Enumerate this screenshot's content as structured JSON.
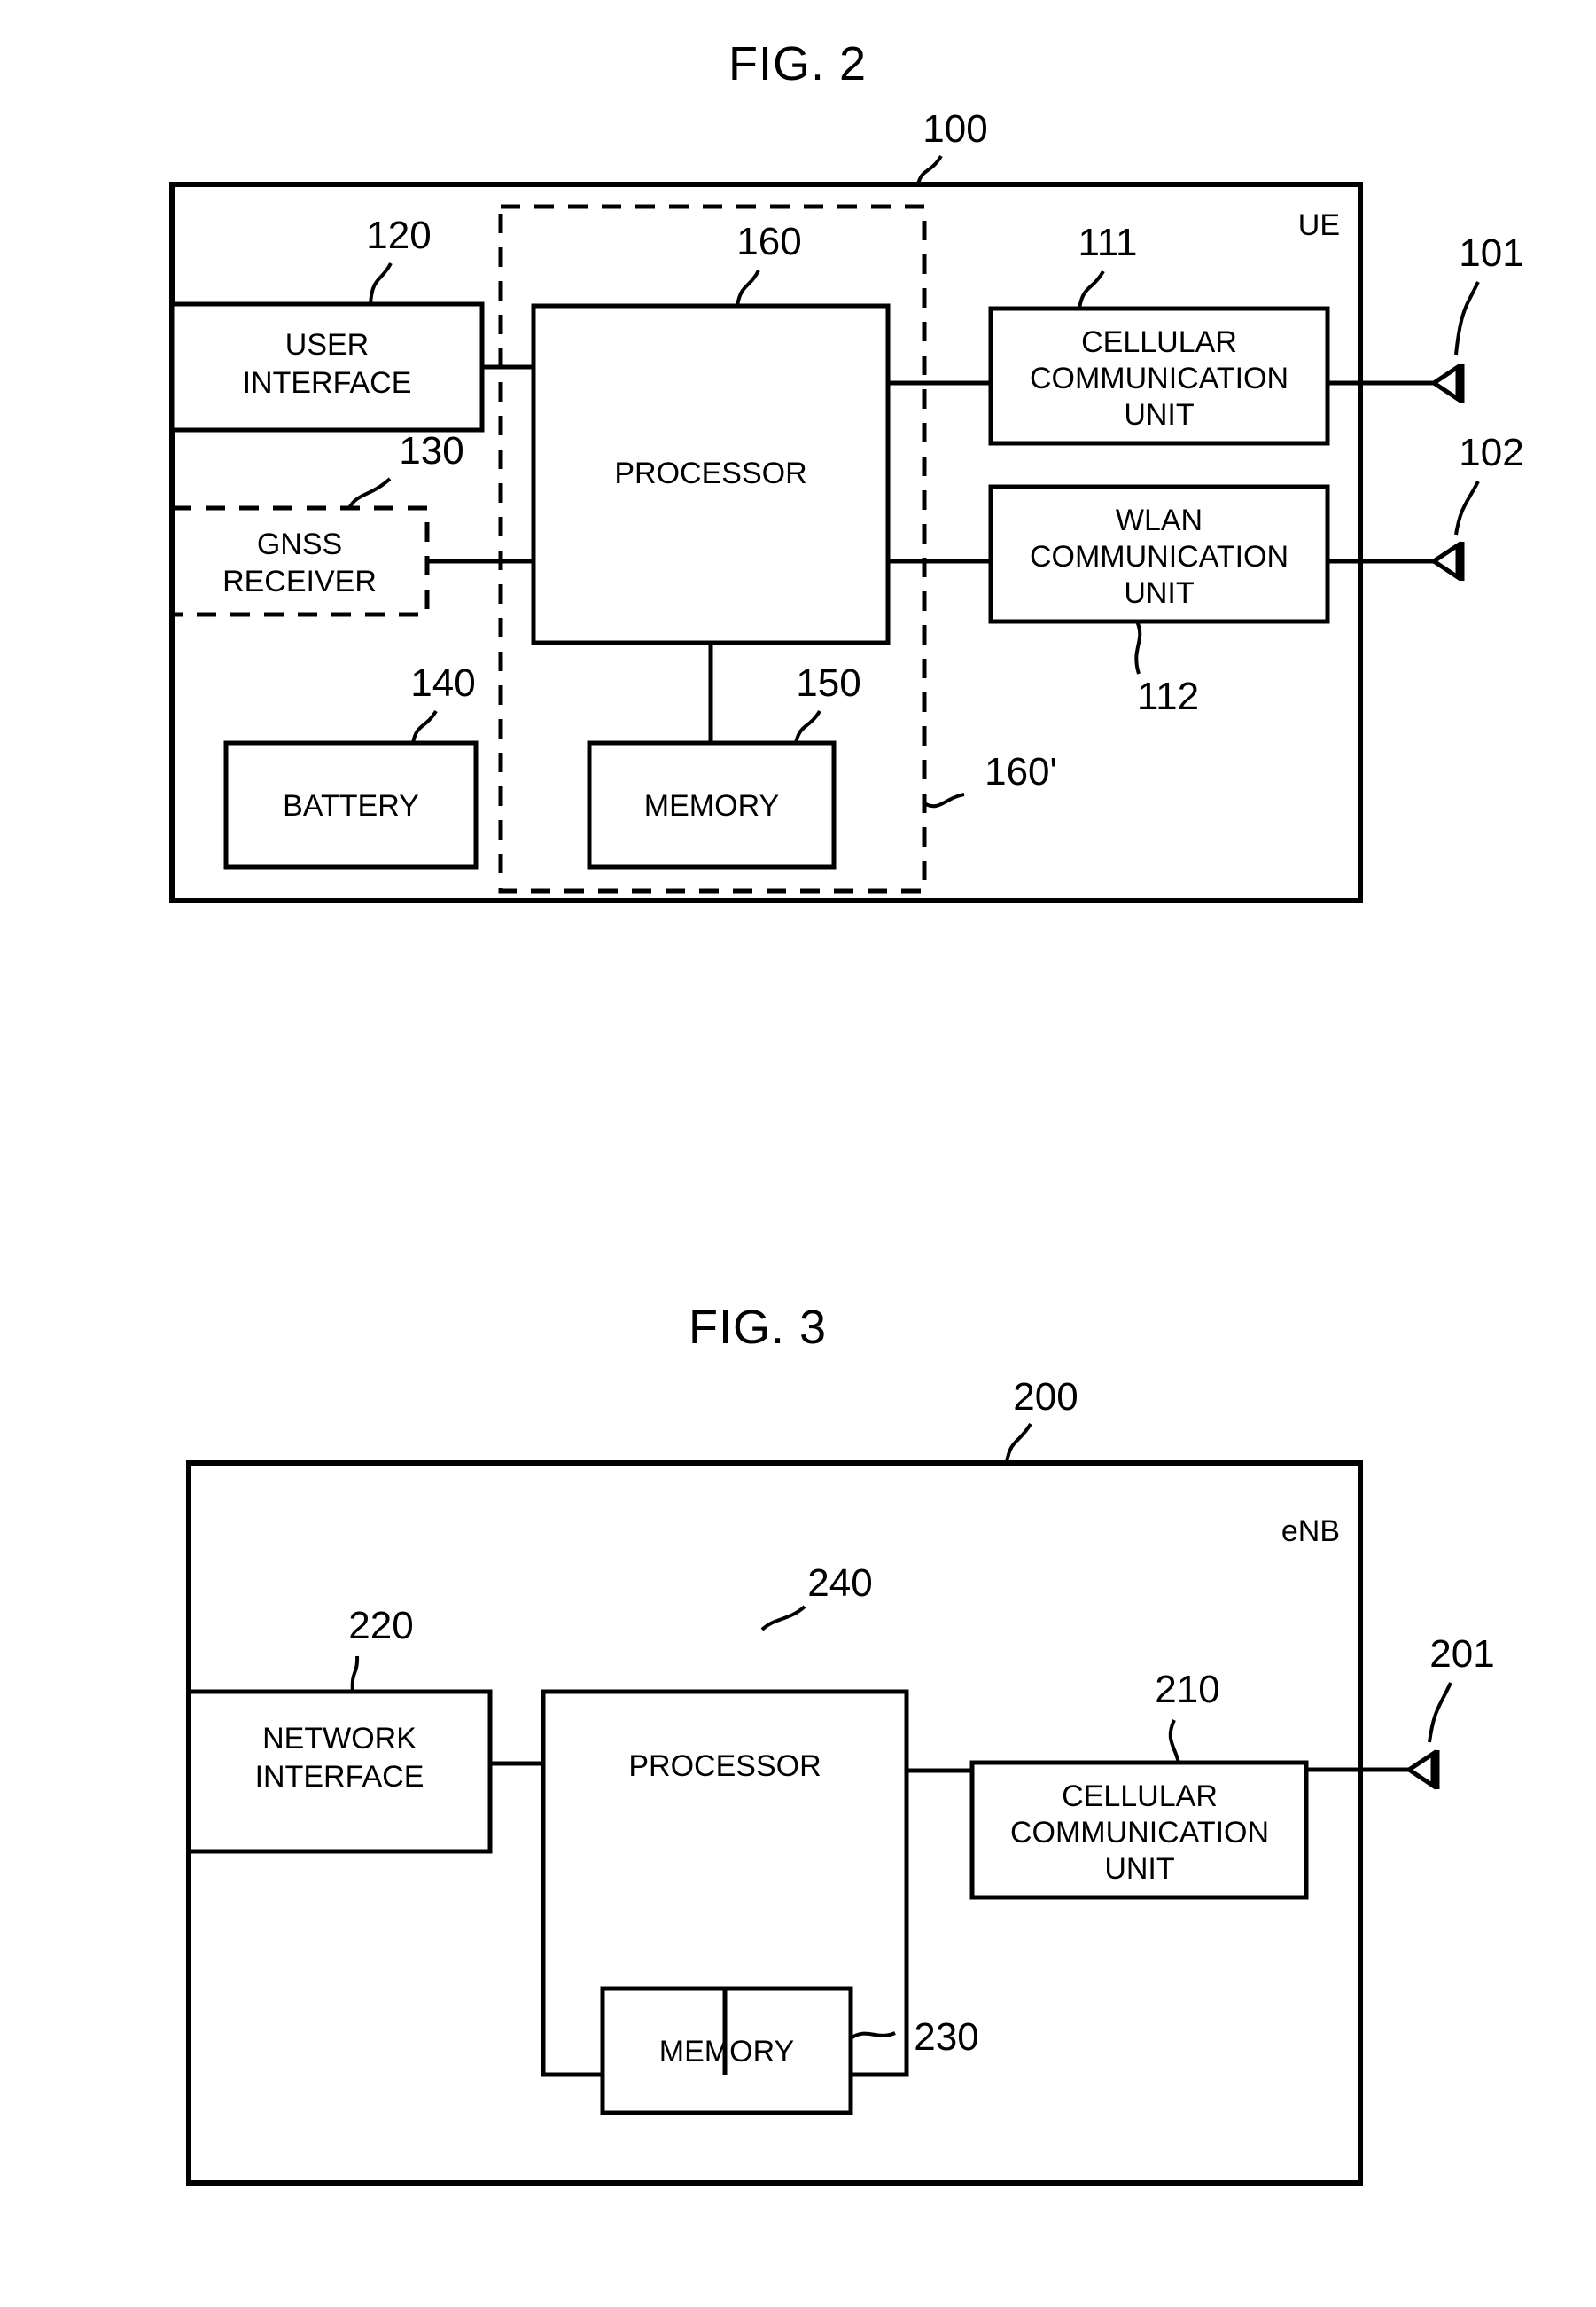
{
  "figures": [
    {
      "id": "fig2",
      "title": "FIG. 2",
      "outer": {
        "ref": "100",
        "entity_label": "UE"
      },
      "blocks": [
        {
          "key": "user_interface",
          "lines": [
            "USER",
            "INTERFACE"
          ],
          "ref": "120",
          "style": "solid"
        },
        {
          "key": "gnss_receiver",
          "lines": [
            "GNSS",
            "RECEIVER"
          ],
          "ref": "130",
          "style": "dashed"
        },
        {
          "key": "battery",
          "lines": [
            "BATTERY"
          ],
          "ref": "140",
          "style": "solid"
        },
        {
          "key": "processor",
          "lines": [
            "PROCESSOR"
          ],
          "ref": "160",
          "style": "solid"
        },
        {
          "key": "memory",
          "lines": [
            "MEMORY"
          ],
          "ref": "150",
          "style": "solid"
        },
        {
          "key": "cellular_communication_unit",
          "lines": [
            "CELLULAR",
            "COMMUNICATION",
            "UNIT"
          ],
          "ref": "111",
          "style": "solid"
        },
        {
          "key": "wlan_communication_unit",
          "lines": [
            "WLAN",
            "COMMUNICATION",
            "UNIT"
          ],
          "ref": "112",
          "style": "solid"
        }
      ],
      "dashed_group": {
        "key": "processor_memory_group",
        "ref": "160'"
      },
      "antennas": [
        {
          "key": "cellular_antenna",
          "ref": "101"
        },
        {
          "key": "wlan_antenna",
          "ref": "102"
        }
      ]
    },
    {
      "id": "fig3",
      "title": "FIG. 3",
      "outer": {
        "ref": "200",
        "entity_label": "eNB"
      },
      "blocks": [
        {
          "key": "network_interface",
          "lines": [
            "NETWORK",
            "INTERFACE"
          ],
          "ref": "220",
          "style": "solid"
        },
        {
          "key": "processor",
          "lines": [
            "PROCESSOR"
          ],
          "ref": "240",
          "style": "solid"
        },
        {
          "key": "memory",
          "lines": [
            "MEMORY"
          ],
          "ref": "230",
          "style": "solid"
        },
        {
          "key": "cellular_communication_unit",
          "lines": [
            "CELLULAR",
            "COMMUNICATION",
            "UNIT"
          ],
          "ref": "210",
          "style": "solid"
        }
      ],
      "antennas": [
        {
          "key": "cellular_antenna",
          "ref": "201"
        }
      ]
    }
  ],
  "text": {
    "fig2_title": "FIG. 2",
    "fig2_ref_100": "100",
    "fig2_ue": "UE",
    "fig2_ref_120": "120",
    "fig2_ui_l1": "USER",
    "fig2_ui_l2": "INTERFACE",
    "fig2_ref_130": "130",
    "fig2_gnss_l1": "GNSS",
    "fig2_gnss_l2": "RECEIVER",
    "fig2_ref_140": "140",
    "fig2_battery": "BATTERY",
    "fig2_ref_160": "160",
    "fig2_processor": "PROCESSOR",
    "fig2_ref_150": "150",
    "fig2_memory": "MEMORY",
    "fig2_ref_160p": "160'",
    "fig2_ref_111": "111",
    "fig2_cell_l1": "CELLULAR",
    "fig2_cell_l2": "COMMUNICATION",
    "fig2_cell_l3": "UNIT",
    "fig2_ref_112": "112",
    "fig2_wlan_l1": "WLAN",
    "fig2_wlan_l2": "COMMUNICATION",
    "fig2_wlan_l3": "UNIT",
    "fig2_ref_101": "101",
    "fig2_ref_102": "102",
    "fig3_title": "FIG. 3",
    "fig3_ref_200": "200",
    "fig3_enb": "eNB",
    "fig3_ref_220": "220",
    "fig3_ni_l1": "NETWORK",
    "fig3_ni_l2": "INTERFACE",
    "fig3_ref_240": "240",
    "fig3_processor": "PROCESSOR",
    "fig3_ref_230": "230",
    "fig3_memory": "MEMORY",
    "fig3_ref_210": "210",
    "fig3_cell_l1": "CELLULAR",
    "fig3_cell_l2": "COMMUNICATION",
    "fig3_cell_l3": "UNIT",
    "fig3_ref_201": "201"
  },
  "colors": {
    "ink": "#000000",
    "paper": "#ffffff"
  }
}
